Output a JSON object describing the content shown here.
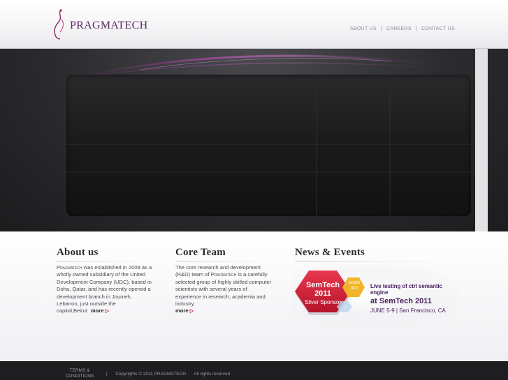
{
  "brand": {
    "name": "PRAGMATECH",
    "accent": "#5c2a62",
    "highlight": "#b3184f"
  },
  "nav": {
    "items": [
      "ABOUT US",
      "CAREERS",
      "CONTACT US"
    ],
    "separator": "|"
  },
  "about": {
    "title": "About us",
    "company": "Pragmatech",
    "body": " was established in 2009 as a wholly owned subsidiary of the United Development Company (UDC), based in Doha, Qatar, and has recently opened a development branch in Jounieh, Lebanon, just outside the capital,Beirut",
    "more": "more",
    "more_icon": "▷"
  },
  "team": {
    "title": "Core Team",
    "body_a": "The core research and development (R&D) team of ",
    "company": "Pragmatech",
    "body_b": " is a carefully selected group of highly skilled computer scientists with several years of experience in research, academia and industry.",
    "more": "more",
    "more_icon": "▷"
  },
  "news": {
    "title": "News & Events",
    "badge": {
      "line1": "SemTech",
      "line2": "2011",
      "line3": "Silver Sponsor"
    },
    "booth": {
      "line1": "booth",
      "line2": "302"
    },
    "headline": "Live testing of ctrl semantic engine",
    "event": "at SemTech 2011",
    "details": "JUNE 5-9 | San Francisco, CA",
    "colors": {
      "hex": "#d6203c",
      "booth": "#f0b528",
      "text": "#4a2260"
    }
  },
  "footer": {
    "terms": "TERMS & CONDITIONS",
    "separator": "|",
    "copyright": "Copyrights © 2011 PRAGMATECH",
    "rights": "All rights reserved"
  }
}
